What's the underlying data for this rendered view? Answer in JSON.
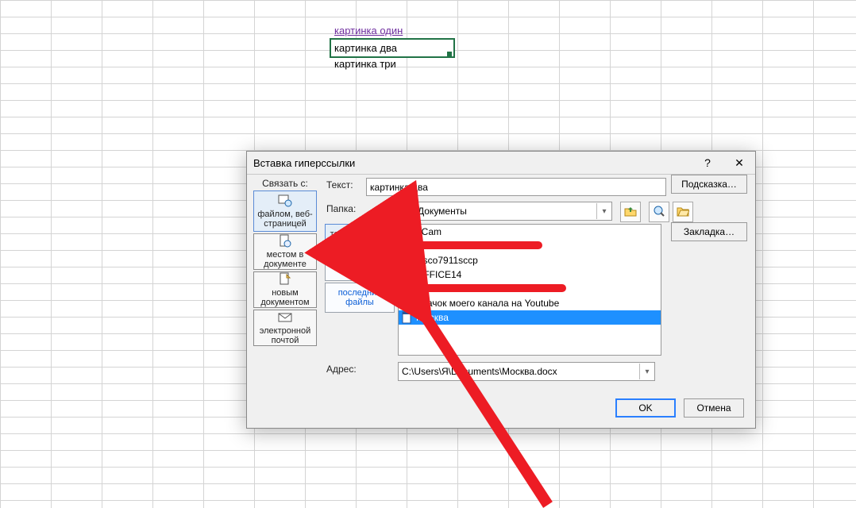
{
  "sheet": {
    "cell_link": "картинка один",
    "cell_selected": "картинка два",
    "cell_below": "картинка три"
  },
  "dialog": {
    "title": "Вставка гиперссылки",
    "help_glyph": "?",
    "close_glyph": "✕",
    "linkto_label": "Связать с:",
    "linkto": {
      "file_web": "файлом, веб-страницей",
      "place_doc": "местом в документе",
      "new_doc": "новым документом",
      "email": "электронной почтой"
    },
    "text_label": "Текст:",
    "text_value": "картинка два",
    "tooltip_btn": "Подсказка…",
    "folder_label": "Папка:",
    "folder_value": "Документы",
    "bookmark_btn": "Закладка…",
    "tabs": {
      "current": "текущая папка",
      "browsed": "просмотренные страницы",
      "recent": "последние файлы"
    },
    "files": [
      {
        "name": "oCam",
        "icon": "folder"
      },
      {
        "name": "",
        "icon": "folder",
        "redacted": true
      },
      {
        "name": "cisco7911sccp",
        "icon": "archive"
      },
      {
        "name": "OFFICE14",
        "icon": "shortcut"
      },
      {
        "name": "",
        "icon": "doc",
        "redacted": true
      },
      {
        "name": "Значок моего канала на Youtube",
        "icon": "doc"
      },
      {
        "name": "Москва",
        "icon": "doc",
        "selected": true
      }
    ],
    "addr_label": "Адрес:",
    "addr_value": "C:\\Users\\Я\\Documents\\Москва.docx",
    "ok": "OK",
    "cancel": "Отмена"
  }
}
